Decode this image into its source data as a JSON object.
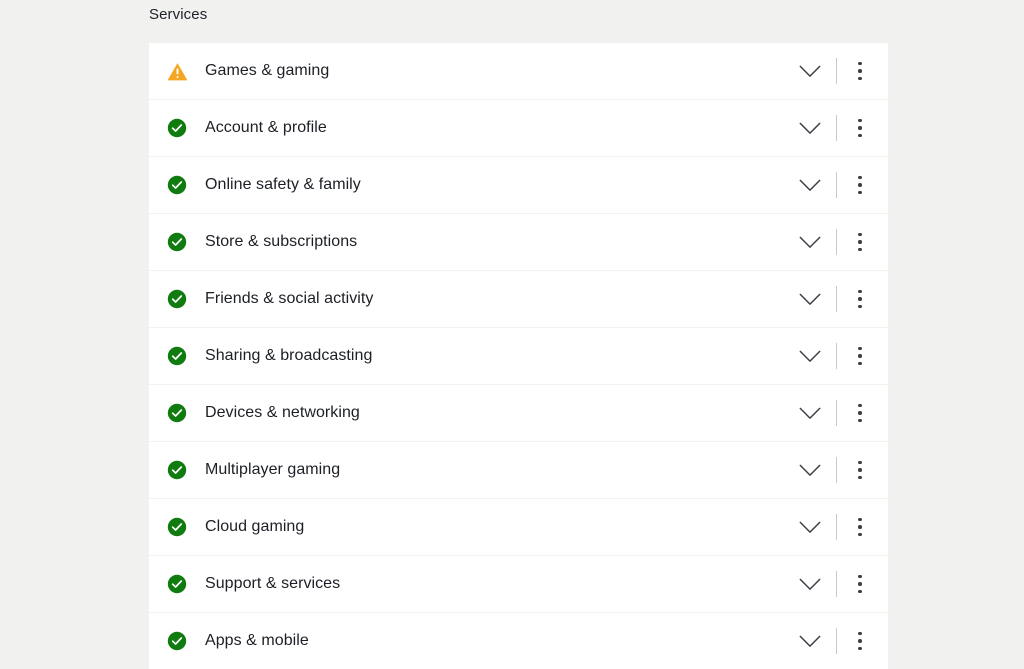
{
  "section": {
    "heading": "Services"
  },
  "colors": {
    "page_background": "#f1f1ef",
    "card_background": "#ffffff",
    "divider": "#f1f1ef",
    "text": "#1c1f25",
    "status_ok": "#107c10",
    "status_warning": "#f5a623",
    "chevron": "#3c3f45",
    "kebab": "#3c3f45",
    "action_divider": "#c9c9c7"
  },
  "icons": {
    "ok": "check-circle-icon",
    "warning": "warning-triangle-icon",
    "expand": "chevron-down-icon",
    "more": "more-vertical-icon"
  },
  "actions": {
    "expand_label": "Expand",
    "more_label": "More options"
  },
  "services": [
    {
      "label": "Games & gaming",
      "status": "warning"
    },
    {
      "label": "Account & profile",
      "status": "ok"
    },
    {
      "label": "Online safety & family",
      "status": "ok"
    },
    {
      "label": "Store & subscriptions",
      "status": "ok"
    },
    {
      "label": "Friends & social activity",
      "status": "ok"
    },
    {
      "label": "Sharing & broadcasting",
      "status": "ok"
    },
    {
      "label": "Devices & networking",
      "status": "ok"
    },
    {
      "label": "Multiplayer gaming",
      "status": "ok"
    },
    {
      "label": "Cloud gaming",
      "status": "ok"
    },
    {
      "label": "Support & services",
      "status": "ok"
    },
    {
      "label": "Apps & mobile",
      "status": "ok"
    }
  ]
}
